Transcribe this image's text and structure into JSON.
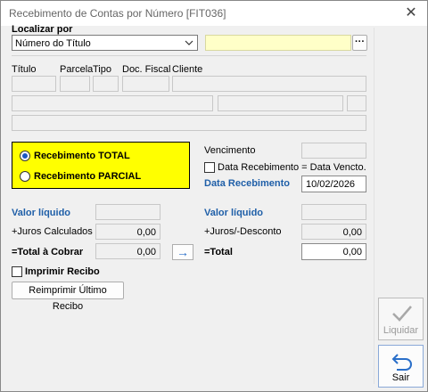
{
  "window": {
    "title": "Recebimento de Contas por Número [FIT036]"
  },
  "localizar": {
    "label": "Localizar por",
    "selected": "Número do Título",
    "search_value": "",
    "ellipsis": "···"
  },
  "columns": {
    "titulo": "Título",
    "parcela": "Parcela",
    "tipo": "Tipo",
    "doc_fiscal": "Doc. Fiscal",
    "cliente": "Cliente"
  },
  "recebimento": {
    "total_label": "Recebimento TOTAL",
    "parcial_label": "Recebimento PARCIAL",
    "selected": "total"
  },
  "datas": {
    "vencimento_label": "Vencimento",
    "data_receb_check_label": "Data Recebimento = Data Vencto.",
    "data_receb_label": "Data Recebimento",
    "data_receb_value": "10/02/2026"
  },
  "left_values": {
    "valor_liquido_label": "Valor líquido",
    "juros_calc_label": "+Juros Calculados",
    "juros_calc_value": "0,00",
    "total_cobrar_label": "=Total à Cobrar",
    "total_cobrar_value": "0,00"
  },
  "right_values": {
    "valor_liquido_label": "Valor líquido",
    "juros_desc_label": "+Juros/-Desconto",
    "juros_desc_value": "0,00",
    "total_label": "=Total",
    "total_value": "0,00"
  },
  "transfer_arrow": "→",
  "imprimir_recibo_label": "Imprimir Recibo",
  "reimprimir_button": "Reimprimir Último Recibo",
  "side_buttons": {
    "liquidar": "Liquidar",
    "sair": "Sair"
  },
  "colors": {
    "accent_blue": "#1f5fa8",
    "radio_yellow": "#ffff00",
    "search_field": "#ffffc8"
  }
}
